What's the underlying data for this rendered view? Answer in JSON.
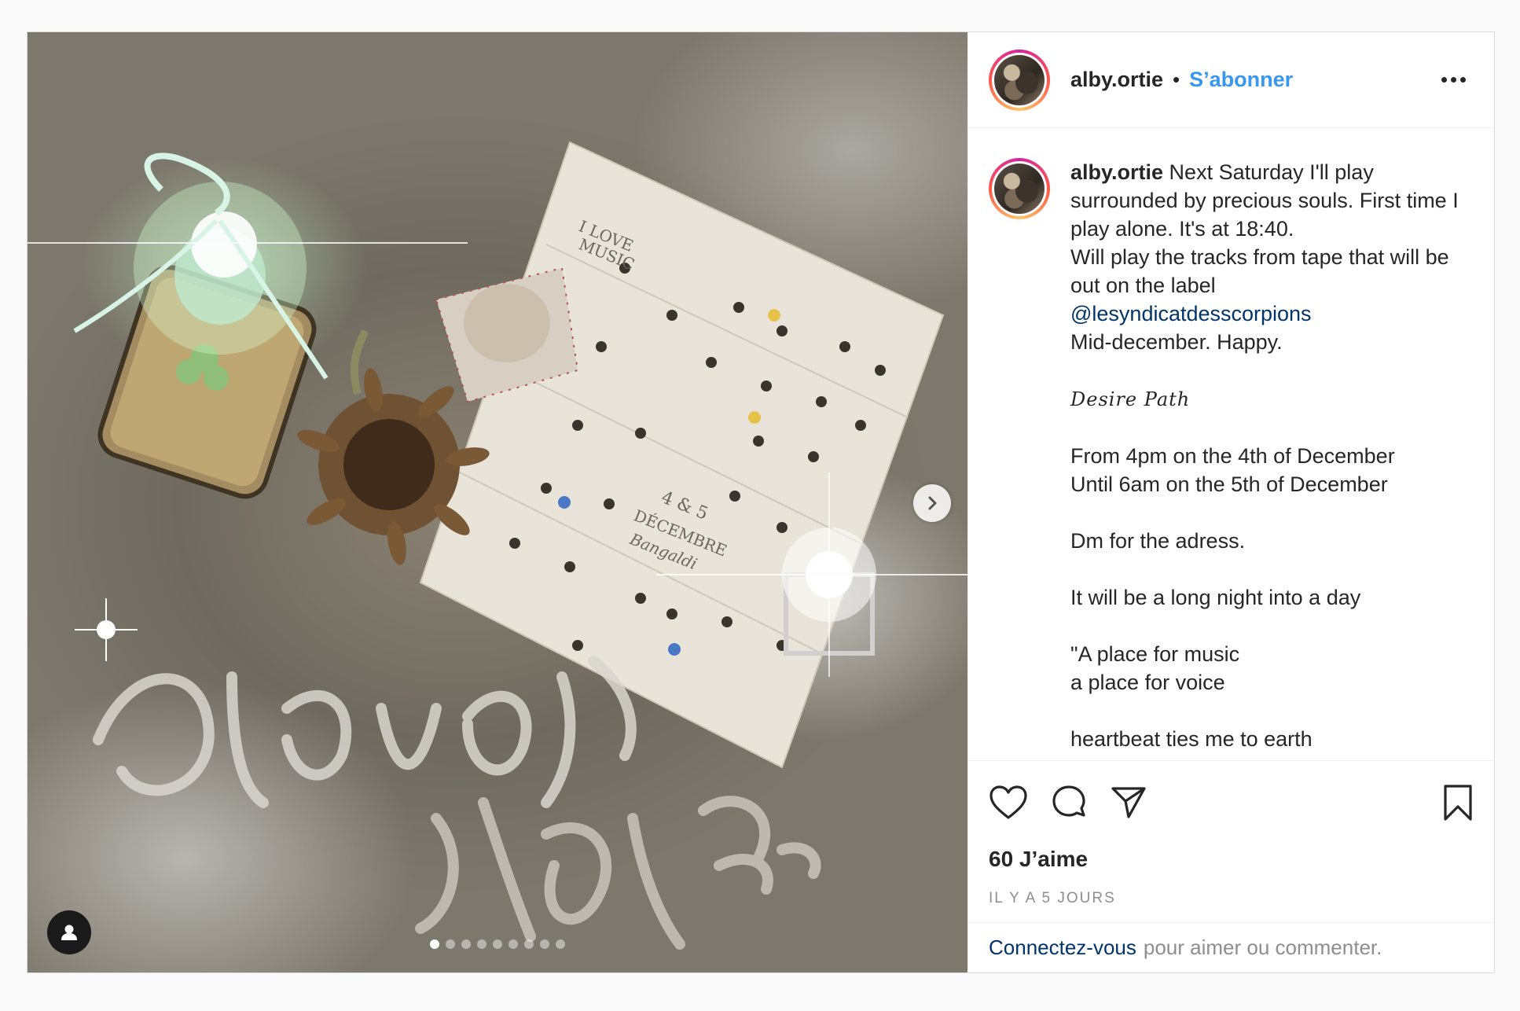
{
  "post": {
    "username": "alby.ortie",
    "follow_label": "S’abonner",
    "separator": "•",
    "carousel": {
      "total_slides": 9,
      "active_index": 0
    },
    "caption": {
      "username": "alby.ortie",
      "text_before_mention": " Next Saturday I'll play surrounded by precious souls. First time I play alone. It's at 18:40.\nWill play the tracks from tape that will be out on the label\n",
      "mention": "@lesyndicatdesscorpions",
      "text_after_mention": "\nMid-december. Happy.\n\n",
      "script_title": "Desire Path",
      "text_rest": "\n\nFrom 4pm on the 4th of December\nUntil 6am on the 5th of December\n\nDm for the adress.\n\nIt will be a long night into a day\n\n\"A place for music\na place for voice\n\nheartbeat ties me to earth"
    },
    "likes": "60 J’aime",
    "time_ago": "IL Y A 5 JOURS",
    "login": {
      "link": "Connectez-vous",
      "text": "pour aimer ou commenter."
    }
  },
  "icons": {
    "like": "heart-icon",
    "comment": "comment-icon",
    "share": "share-icon",
    "save": "bookmark-icon",
    "more": "more-icon",
    "next": "chevron-right-icon",
    "user_tag": "user-icon"
  },
  "colors": {
    "follow": "#3897f0",
    "link": "#003569",
    "secondary_text": "#8e8e8e",
    "border": "#dbdbdb"
  }
}
